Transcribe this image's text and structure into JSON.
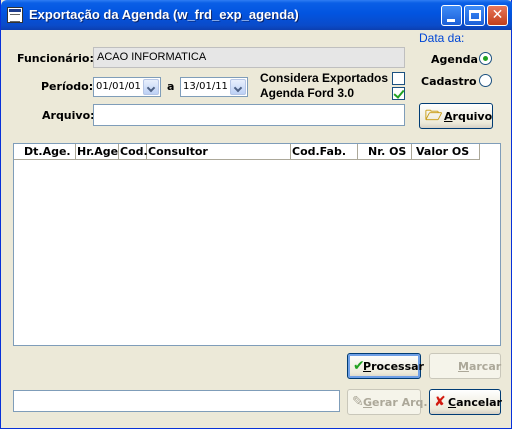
{
  "window": {
    "title": "Exportação da Agenda (w_frd_exp_agenda)",
    "controls": [
      "minimize-icon",
      "maximize-icon",
      "close-icon"
    ]
  },
  "form": {
    "funcionario_label": "Funcionário:",
    "funcionario_value": "ACAO INFORMATICA",
    "periodo_label": "Período:",
    "periodo_start": "01/01/01",
    "periodo_sep": "a",
    "periodo_end": "13/01/11",
    "arquivo_label": "Arquivo:",
    "arquivo_value": "",
    "considera_label": "Considera Exportados",
    "considera_checked": false,
    "agenda_ford_label": "Agenda Ford 3.0",
    "agenda_ford_checked": true
  },
  "data_da": {
    "title": "Data da:",
    "options": [
      {
        "label": "Agenda",
        "selected": true
      },
      {
        "label": "Cadastro",
        "selected": false
      }
    ]
  },
  "buttons": {
    "arquivo": {
      "label_u": "A",
      "label_rest": "rquivo",
      "icon": "folder-open-icon"
    },
    "processar": {
      "label_u": "P",
      "label_rest": "rocessar",
      "icon": "check-icon"
    },
    "marcar": {
      "label_u": "M",
      "label_rest": "arcar"
    },
    "gerar": {
      "label_u": "G",
      "label_rest": "erar Arq.",
      "icon": "pen-icon"
    },
    "cancelar": {
      "label_u": "C",
      "label_rest": "ancelar",
      "icon": "x-icon"
    }
  },
  "grid": {
    "columns": [
      "Dt.Age.",
      "Hr.Age.",
      "Cod.",
      "Consultor",
      "Cod.Fab.",
      "Nr. OS",
      "Valor OS"
    ],
    "rows": []
  },
  "status": {
    "value": ""
  },
  "colors": {
    "accent": "#0a5fe6",
    "group_title": "#0046d5",
    "check": "#21a121"
  }
}
